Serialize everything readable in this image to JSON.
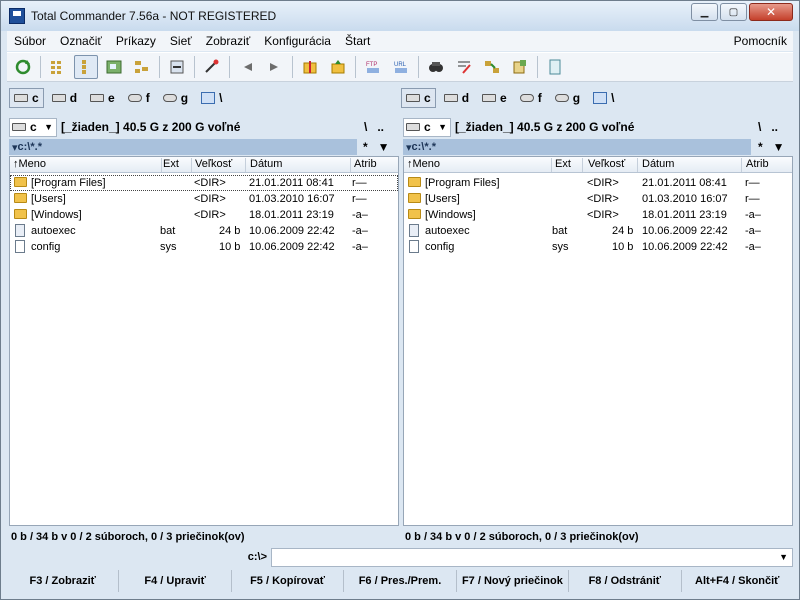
{
  "window": {
    "title": "Total Commander 7.56a - NOT REGISTERED",
    "min": "▁",
    "max": "▢",
    "close": "✕"
  },
  "menu": [
    "Súbor",
    "Označiť",
    "Príkazy",
    "Sieť",
    "Zobraziť",
    "Konfigurácia",
    "Štart"
  ],
  "menu_right": "Pomocník",
  "toolbar_icons": [
    "refresh-icon",
    "brief-view-icon",
    "full-view-icon",
    "thumbnail-view-icon",
    "tree-view-icon",
    "invert-selection-icon",
    "unpack-icon",
    "back-icon",
    "forward-icon",
    "pack-icon",
    "unpack-files-icon",
    "ftp-connect-icon",
    "url-connect-icon",
    "search-icon",
    "multi-rename-icon",
    "sync-dirs-icon",
    "notepad-icon",
    "copy-names-icon"
  ],
  "drives": [
    "c",
    "d",
    "e",
    "f",
    "g",
    "\\"
  ],
  "left": {
    "drive": "c",
    "drive_info": "[_žiaden_]  40.5  G z  200 G voľné",
    "root_buttons": [
      "\\",
      ".."
    ],
    "path": "c:\\*.*",
    "filter": "*",
    "columns": {
      "name": "Meno",
      "ext": "Ext",
      "size": "Veľkosť",
      "date": "Dátum",
      "attr": "Atrib"
    },
    "files": [
      {
        "name": "[Program Files]",
        "ext": "",
        "size": "<DIR>",
        "date": "21.01.2011 08:41",
        "attr": "r—",
        "type": "folder"
      },
      {
        "name": "[Users]",
        "ext": "",
        "size": "<DIR>",
        "date": "01.03.2010 16:07",
        "attr": "r—",
        "type": "folder"
      },
      {
        "name": "[Windows]",
        "ext": "",
        "size": "<DIR>",
        "date": "18.01.2011 23:19",
        "attr": "-a–",
        "type": "folder"
      },
      {
        "name": "autoexec",
        "ext": "bat",
        "size": "24 b",
        "date": "10.06.2009 22:42",
        "attr": "-a–",
        "type": "file"
      },
      {
        "name": "config",
        "ext": "sys",
        "size": "10 b",
        "date": "10.06.2009 22:42",
        "attr": "-a–",
        "type": "file"
      }
    ],
    "status": "0 b / 34 b v 0 / 2 súboroch, 0 / 3 priečinok(ov)"
  },
  "right": {
    "drive": "c",
    "drive_info": "[_žiaden_]  40.5  G z  200 G voľné",
    "root_buttons": [
      "\\",
      ".."
    ],
    "path": "c:\\*.*",
    "filter": "*",
    "columns": {
      "name": "Meno",
      "ext": "Ext",
      "size": "Veľkosť",
      "date": "Dátum",
      "attr": "Atrib"
    },
    "files": [
      {
        "name": "[Program Files]",
        "ext": "",
        "size": "<DIR>",
        "date": "21.01.2011 08:41",
        "attr": "r—",
        "type": "folder"
      },
      {
        "name": "[Users]",
        "ext": "",
        "size": "<DIR>",
        "date": "01.03.2010 16:07",
        "attr": "r—",
        "type": "folder"
      },
      {
        "name": "[Windows]",
        "ext": "",
        "size": "<DIR>",
        "date": "18.01.2011 23:19",
        "attr": "-a–",
        "type": "folder"
      },
      {
        "name": "autoexec",
        "ext": "bat",
        "size": "24 b",
        "date": "10.06.2009 22:42",
        "attr": "-a–",
        "type": "file"
      },
      {
        "name": "config",
        "ext": "sys",
        "size": "10 b",
        "date": "10.06.2009 22:42",
        "attr": "-a–",
        "type": "file"
      }
    ],
    "status": "0 b / 34 b v 0 / 2 súboroch, 0 / 3 priečinok(ov)"
  },
  "command": {
    "prompt": "c:\\>",
    "value": ""
  },
  "fkeys": [
    "F3 / Zobraziť",
    "F4 / Upraviť",
    "F5 / Kopírovať",
    "F6 / Pres./Prem.",
    "F7 / Nový priečinok",
    "F8 / Odstrániť",
    "Alt+F4 / Skončiť"
  ]
}
